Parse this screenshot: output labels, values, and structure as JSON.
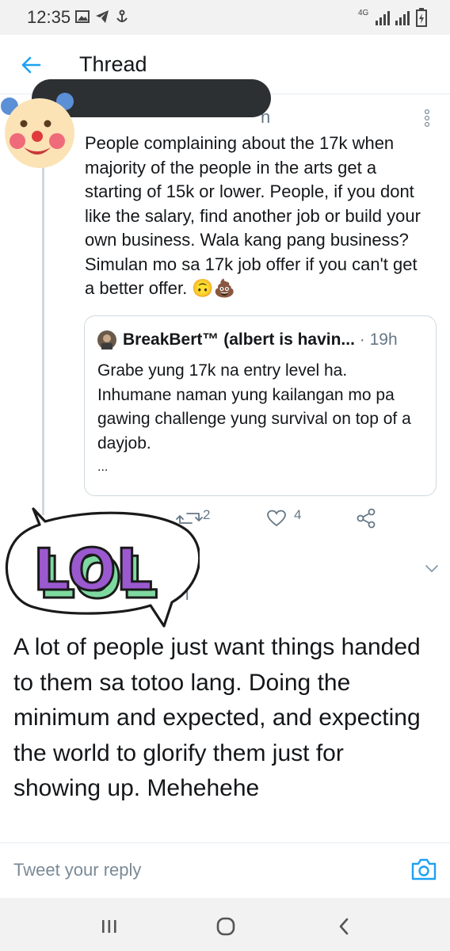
{
  "status_bar": {
    "time": "12:35",
    "network": "4G"
  },
  "header": {
    "title": "Thread"
  },
  "tweet": {
    "author_fragment": "n",
    "text": "People complaining about the 17k when majority of the people in the arts get a starting of 15k or lower. People, if you dont like the salary, find another job or build your own business. Wala kang pang business? Simulan mo sa 17k job offer if you can't get a better offer. 🙃💩",
    "quote": {
      "author": "BreakBert™ (albert is havin...",
      "time": "· 19h",
      "text": "Grabe yung 17k na entry level ha. Inhumane naman yung kailangan mo pa gawing challenge yung survival on top of a dayjob.",
      "more": "..."
    },
    "retweets": "2",
    "likes": "4"
  },
  "sticker": {
    "text": "LOL"
  },
  "reply": {
    "author_fragment": "l",
    "text": "A lot of people just want things handed to them sa totoo lang. Doing the minimum and expected, and expecting the world to glorify them just for showing up. Mehehehe"
  },
  "compose": {
    "placeholder": "Tweet your reply"
  },
  "colors": {
    "accent": "#1da1f2",
    "sticker_purple": "#9b59d0",
    "sticker_green": "#7ed9a0"
  }
}
